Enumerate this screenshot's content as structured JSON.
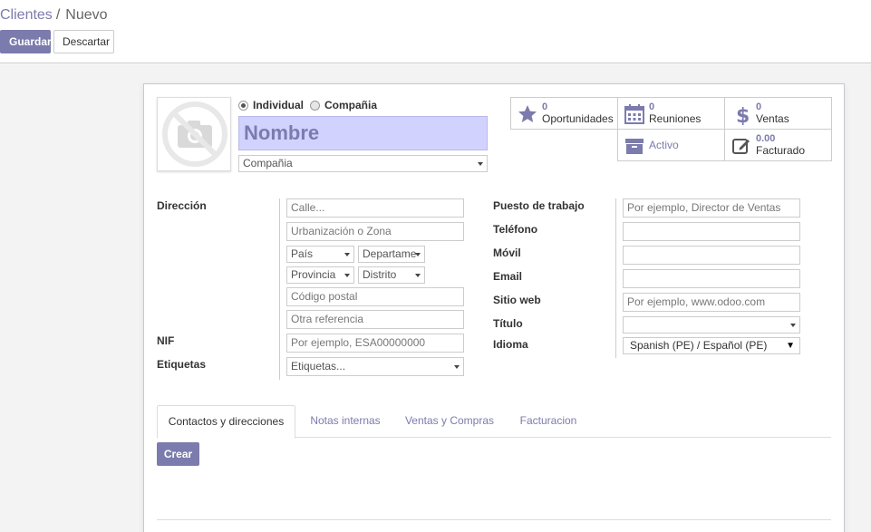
{
  "breadcrumb": {
    "parent": "Clientes",
    "separator": "/",
    "current": "Nuevo"
  },
  "toolbar": {
    "save_label": "Guardar",
    "discard_label": "Descartar"
  },
  "colors": {
    "primary": "#7c7bad",
    "name_bg": "#d2d2ff"
  },
  "header": {
    "radio_individual": "Individual",
    "radio_company": "Compañia",
    "selected_type": "Individual",
    "name_placeholder": "Nombre",
    "company_select": "Compañia"
  },
  "stat_buttons": {
    "opportunities": {
      "value": "0",
      "label": "Oportunidades",
      "icon": "star-icon"
    },
    "meetings": {
      "value": "0",
      "label": "Reuniones",
      "icon": "calendar-icon"
    },
    "sales": {
      "value": "0",
      "label": "Ventas",
      "icon": "dollar-icon"
    },
    "active": {
      "label": "Activo",
      "icon": "archive-icon"
    },
    "invoiced": {
      "value": "0.00",
      "label": "Facturado",
      "icon": "pencil-square-icon"
    }
  },
  "left_fields": {
    "address_label": "Dirección",
    "street_placeholder": "Calle...",
    "street2_placeholder": "Urbanización o Zona",
    "country_placeholder": "País",
    "state_placeholder": "Departame",
    "province_placeholder": "Provincia",
    "district_placeholder": "Distrito",
    "zip_placeholder": "Código postal",
    "ref_placeholder": "Otra referencia",
    "vat_label": "NIF",
    "vat_placeholder": "Por ejemplo, ESA00000000",
    "tags_label": "Etiquetas",
    "tags_placeholder": "Etiquetas..."
  },
  "right_fields": {
    "job_label": "Puesto de trabajo",
    "job_placeholder": "Por ejemplo, Director de Ventas",
    "phone_label": "Teléfono",
    "mobile_label": "Móvil",
    "email_label": "Email",
    "website_label": "Sitio web",
    "website_placeholder": "Por ejemplo, www.odoo.com",
    "title_label": "Título",
    "language_label": "Idioma",
    "language_value": "Spanish (PE) / Español (PE)"
  },
  "tabs": [
    {
      "label": "Contactos y direcciones",
      "active": true
    },
    {
      "label": "Notas internas",
      "active": false
    },
    {
      "label": "Ventas y Compras",
      "active": false
    },
    {
      "label": "Facturacion",
      "active": false
    }
  ],
  "create_label": "Crear"
}
